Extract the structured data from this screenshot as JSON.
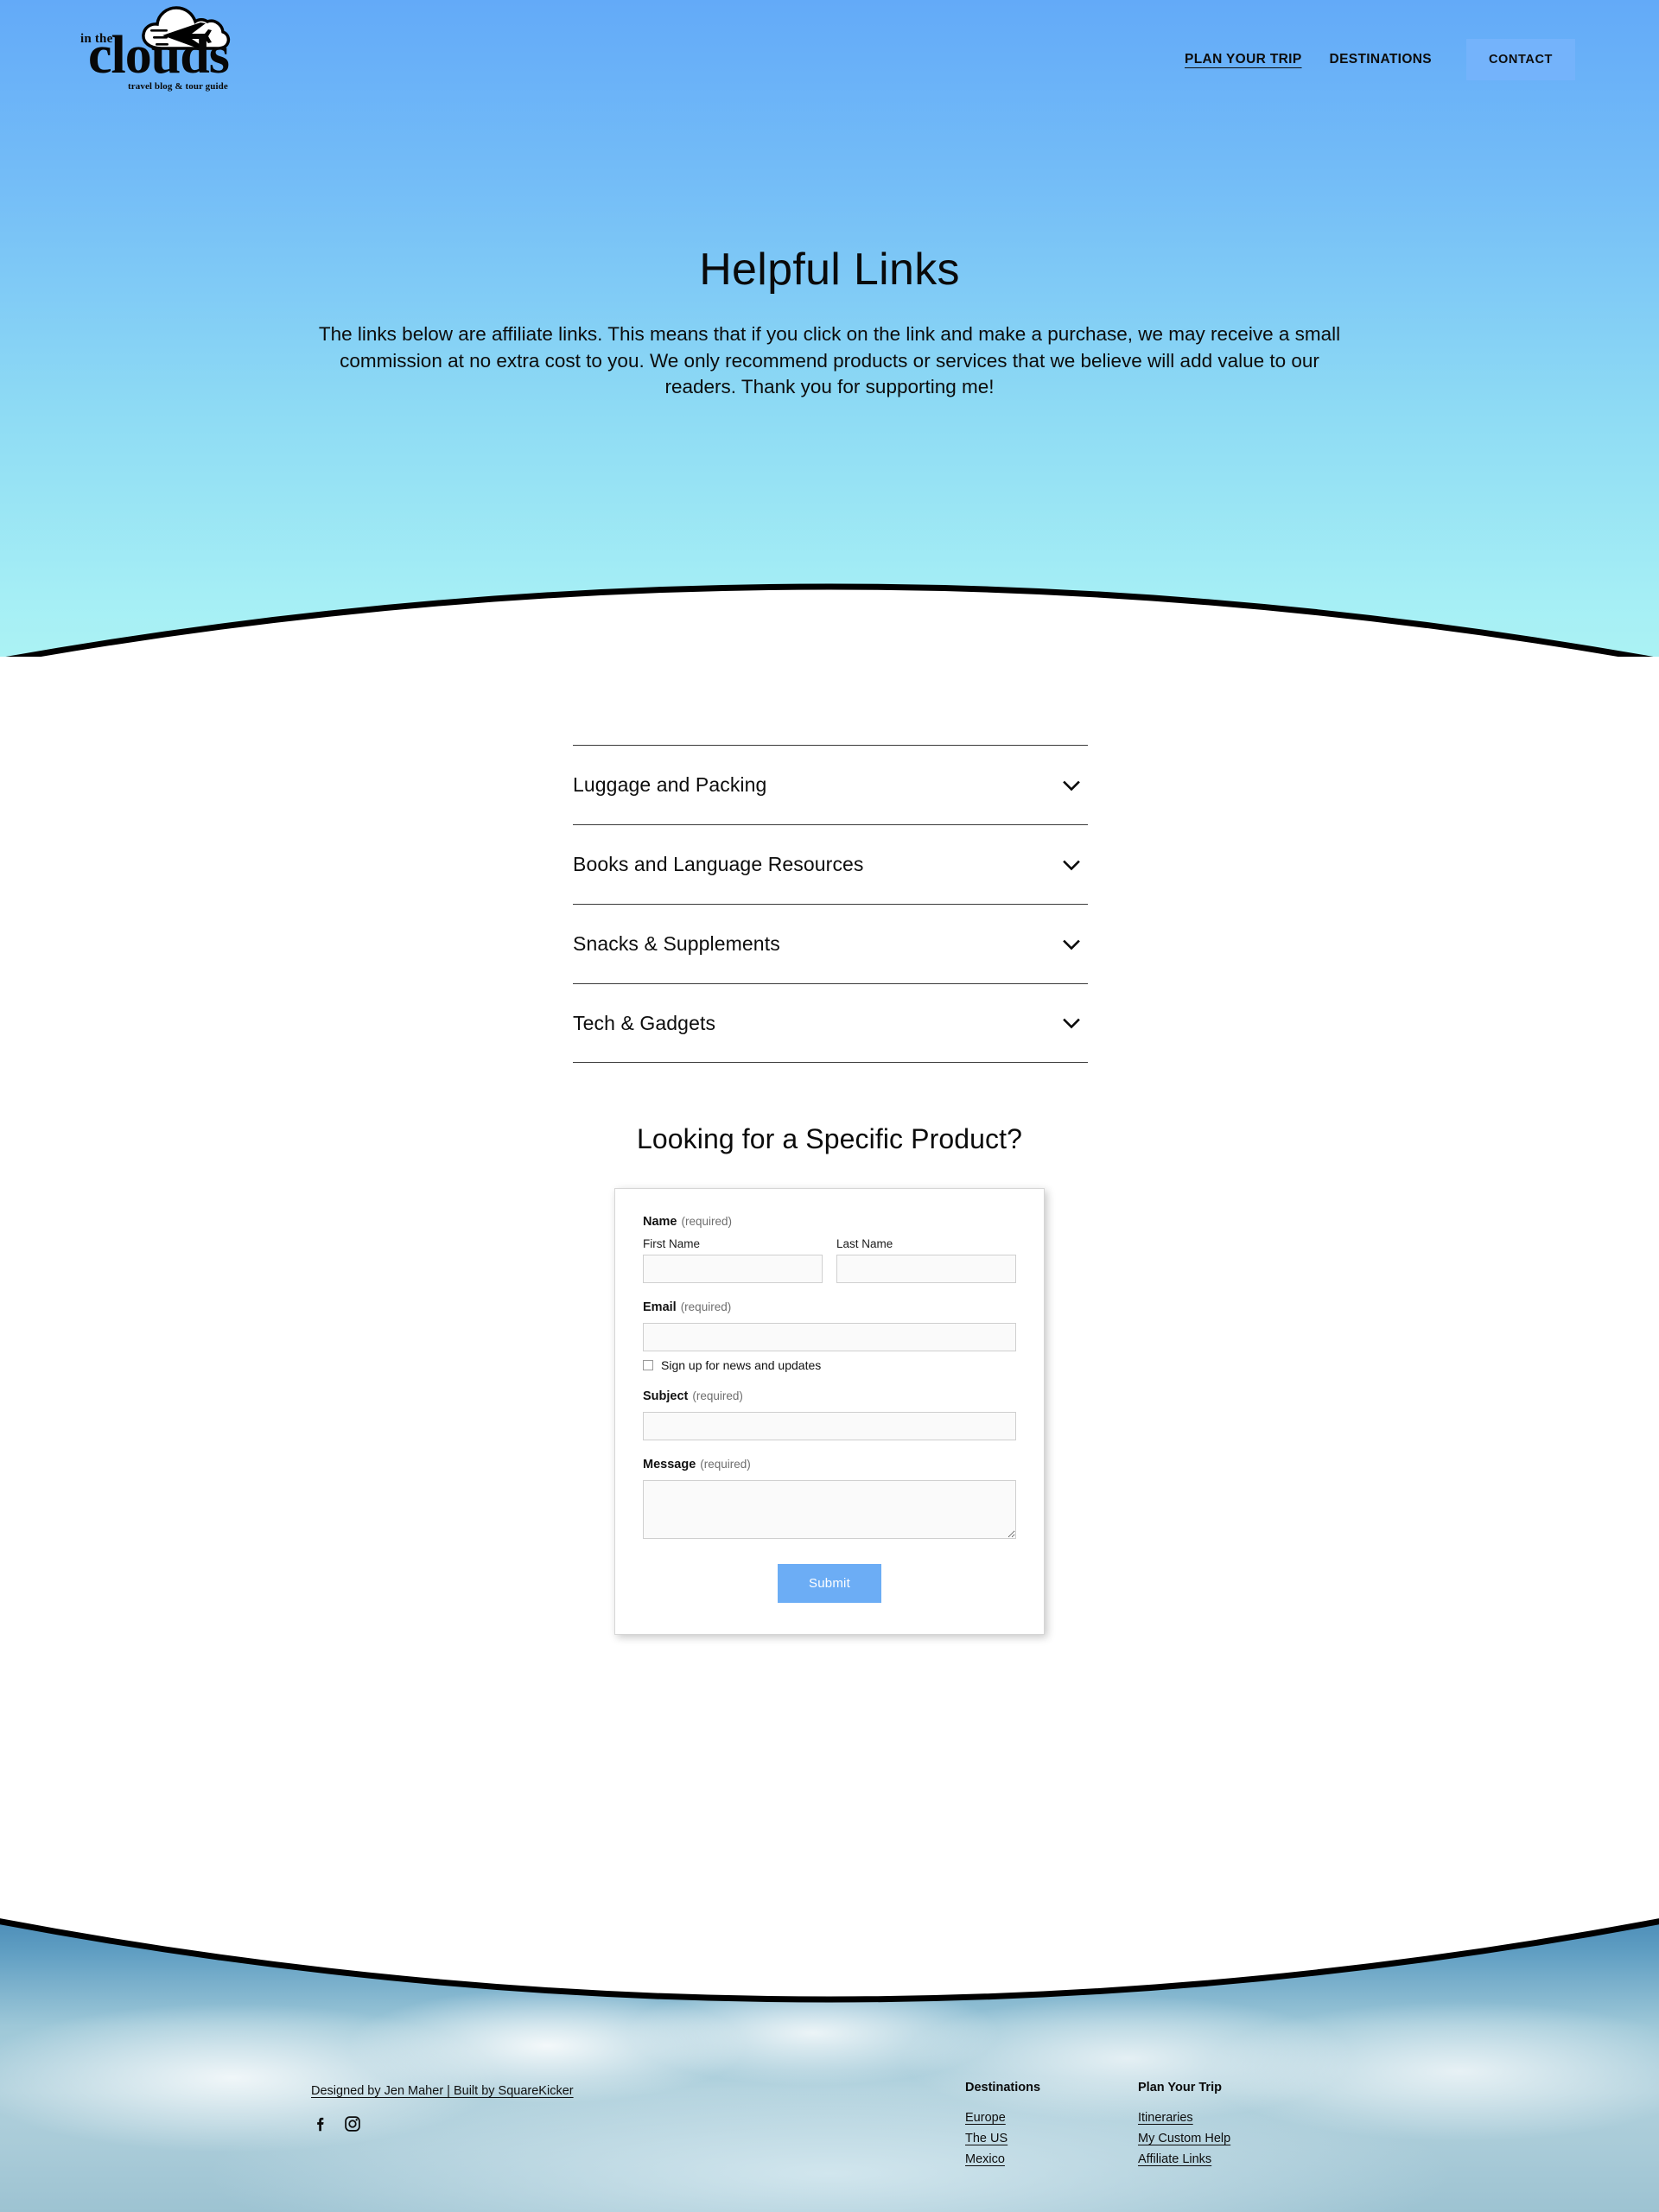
{
  "header": {
    "logo": {
      "small_text": "in the",
      "word": "clouds",
      "tagline": "travel blog & tour guide"
    },
    "nav": [
      {
        "label": "PLAN YOUR TRIP",
        "active": true
      },
      {
        "label": "DESTINATIONS",
        "active": false
      }
    ],
    "cta_label": "CONTACT"
  },
  "hero": {
    "title": "Helpful Links",
    "paragraph": "The links below are affiliate links. This means that if you click on the link and make a purchase, we may receive a small commission at no extra cost to you. We only recommend products or services that we believe will add value to our readers. Thank you for supporting me!",
    "gradient_top": "#63aaf8",
    "gradient_bottom": "#abf2f4"
  },
  "accordion": {
    "items": [
      {
        "label": "Luggage and Packing",
        "icon": "chevron-down-icon",
        "expanded": false
      },
      {
        "label": "Books and Language Resources",
        "icon": "chevron-down-icon",
        "expanded": false
      },
      {
        "label": "Snacks & Supplements",
        "icon": "chevron-down-icon",
        "expanded": false
      },
      {
        "label": "Tech & Gadgets",
        "icon": "chevron-down-icon",
        "expanded": false
      }
    ]
  },
  "form": {
    "heading": "Looking for a Specific Product?",
    "name": {
      "legend": "Name",
      "required": "(required)",
      "first_label": "First Name",
      "first_value": "",
      "last_label": "Last Name",
      "last_value": ""
    },
    "email": {
      "legend": "Email",
      "required": "(required)",
      "value": "",
      "checkbox_label": "Sign up for news and updates",
      "checkbox_checked": false
    },
    "subject": {
      "legend": "Subject",
      "required": "(required)",
      "value": ""
    },
    "message": {
      "legend": "Message",
      "required": "(required)",
      "value": ""
    },
    "submit_label": "Submit",
    "submit_color": "#6cadf5"
  },
  "footer": {
    "credit": "Designed by Jen Maher | Built by SquareKicker",
    "socials": [
      {
        "name": "facebook-icon"
      },
      {
        "name": "instagram-icon"
      }
    ],
    "columns": [
      {
        "title": "Destinations",
        "links": [
          "Europe",
          "The US",
          "Mexico"
        ]
      },
      {
        "title": "Plan Your Trip",
        "links": [
          "Itineraries",
          "My Custom Help",
          "Affiliate Links"
        ]
      }
    ]
  }
}
